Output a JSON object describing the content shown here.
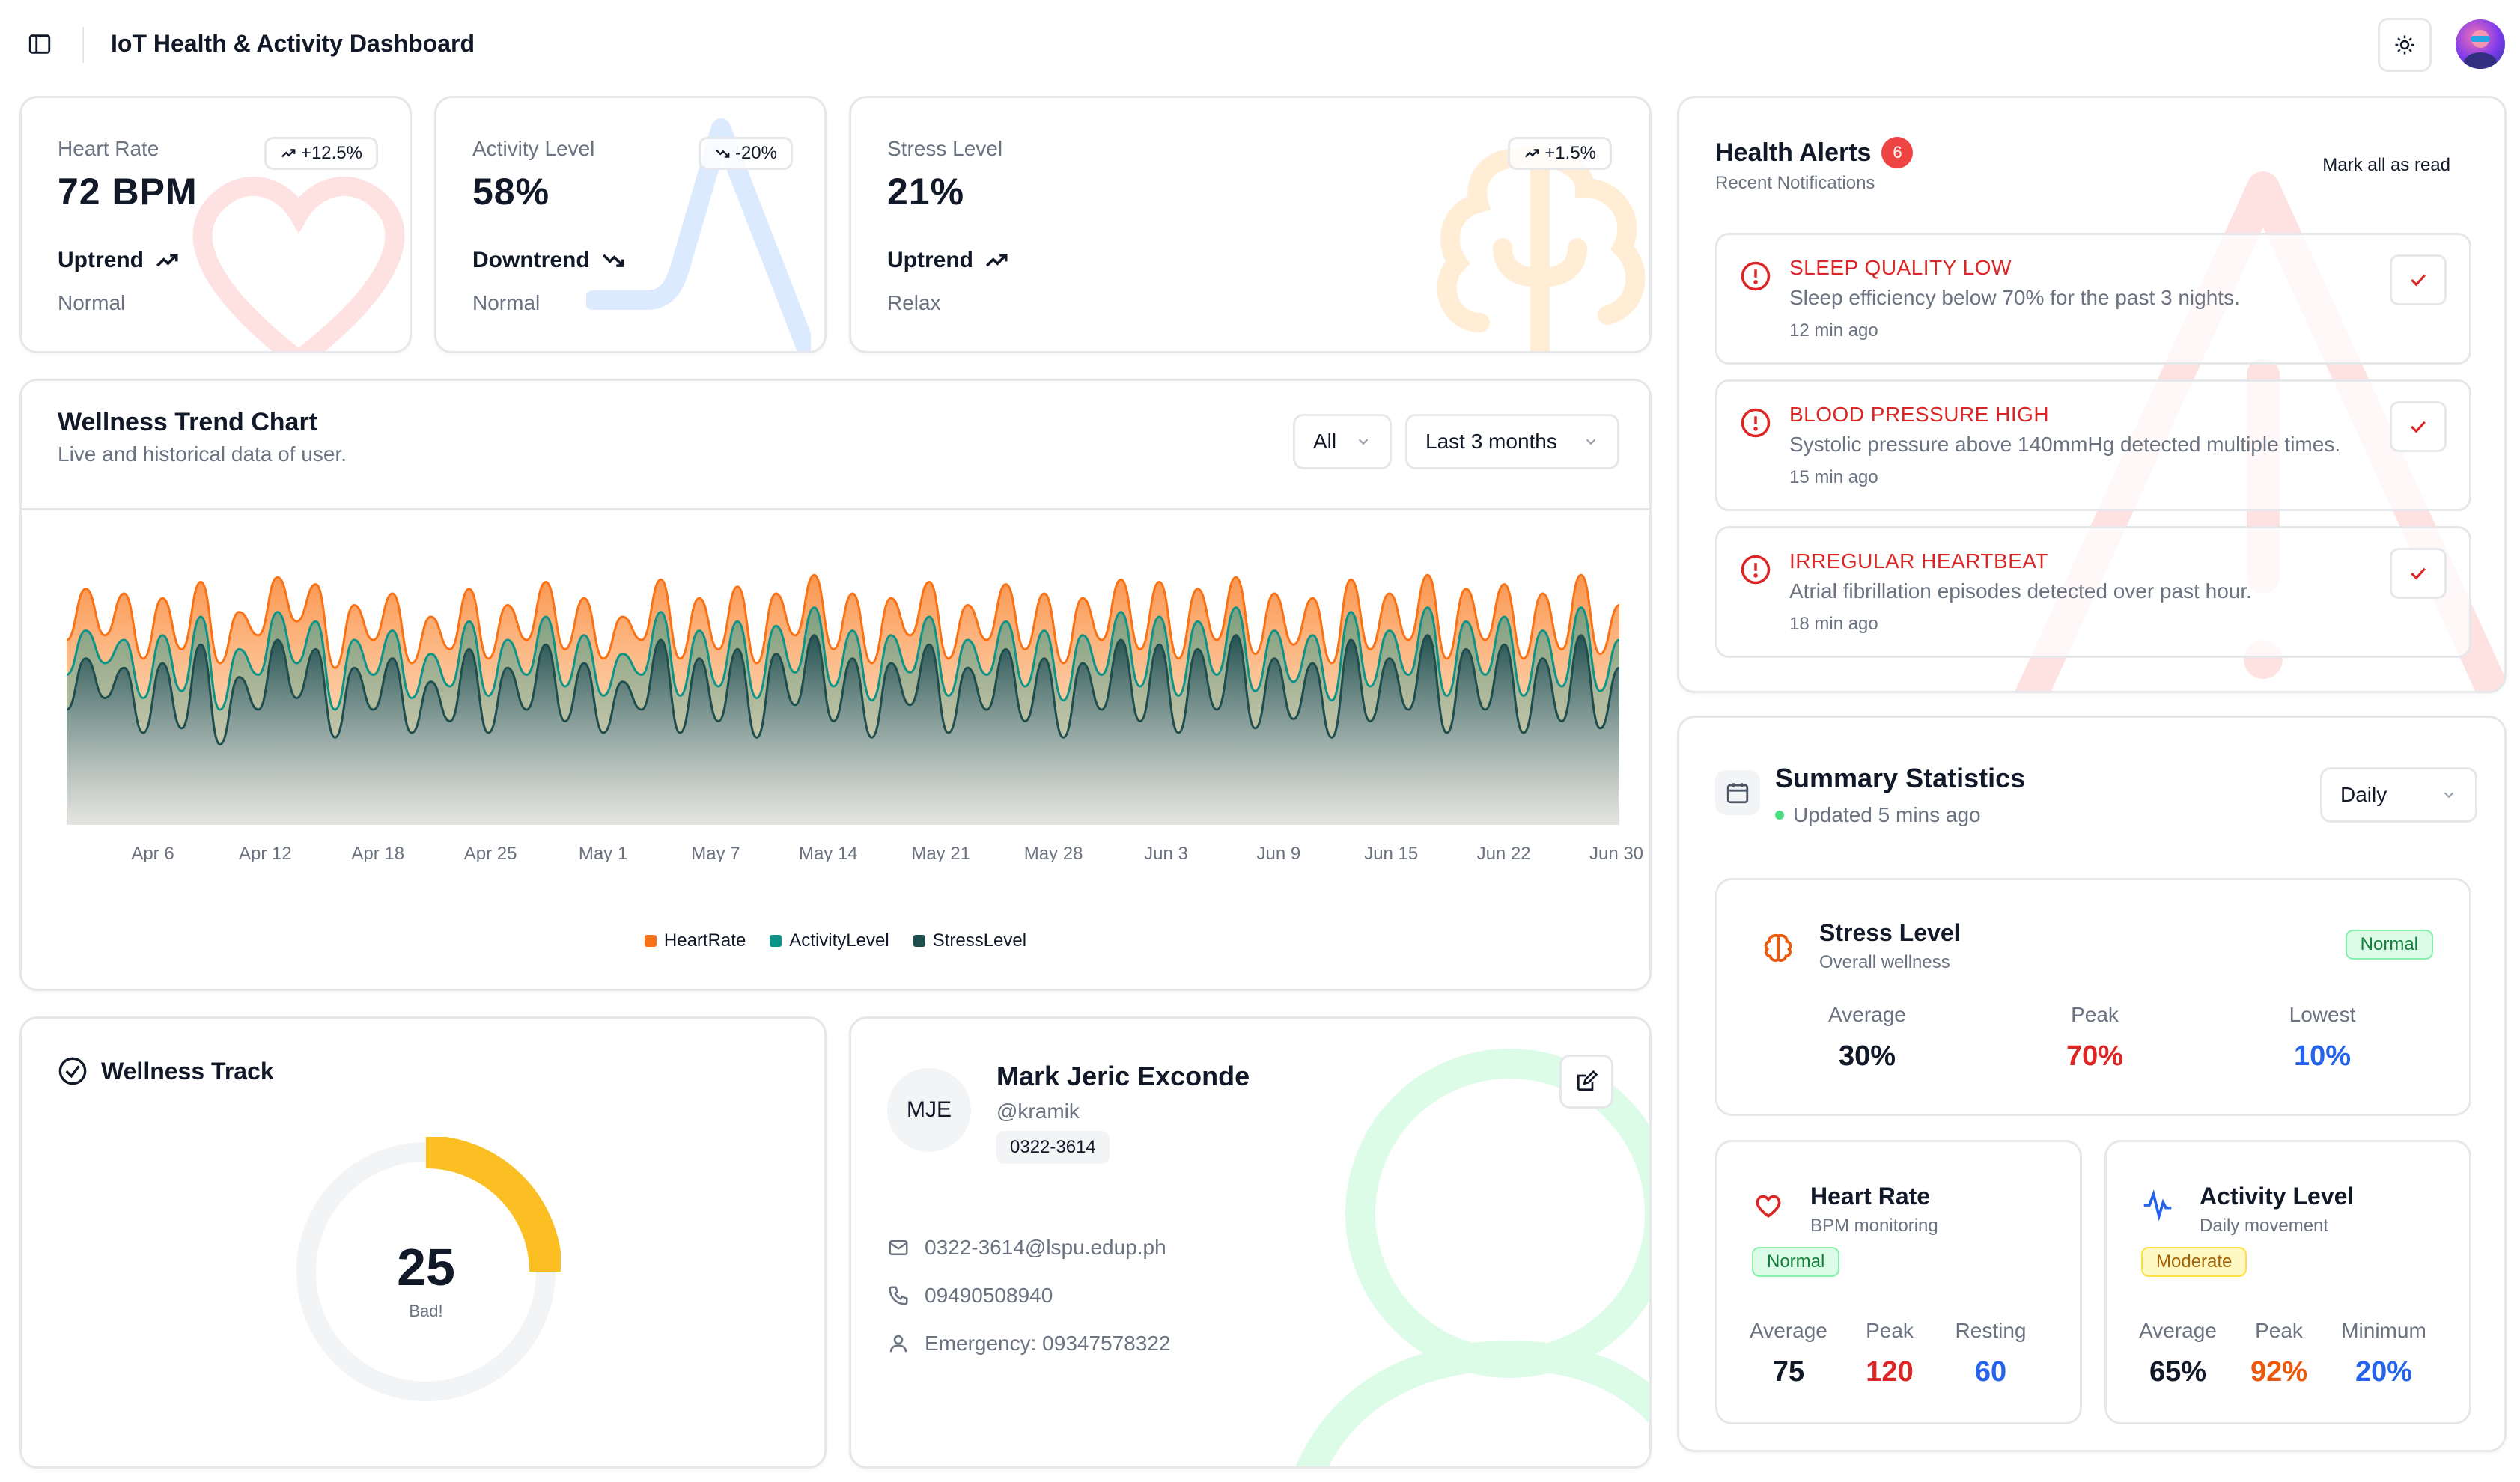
{
  "header": {
    "title": "IoT Health & Activity Dashboard"
  },
  "metrics": [
    {
      "label": "Heart Rate",
      "value": "72 BPM",
      "change": "+12.5%",
      "trend": "Uptrend",
      "status": "Normal"
    },
    {
      "label": "Activity Level",
      "value": "58%",
      "change": "-20%",
      "trend": "Downtrend",
      "status": "Normal"
    },
    {
      "label": "Stress Level",
      "value": "21%",
      "change": "+1.5%",
      "trend": "Uptrend",
      "status": "Relax"
    }
  ],
  "wellness_chart": {
    "title": "Wellness Trend Chart",
    "subtitle": "Live and historical data of user.",
    "filter_value": "All",
    "range_value": "Last 3 months"
  },
  "chart_data": {
    "type": "area",
    "x_tick_labels": [
      "Apr 6",
      "Apr 12",
      "Apr 18",
      "Apr 25",
      "May 1",
      "May 7",
      "May 14",
      "May 21",
      "May 28",
      "Jun 3",
      "Jun 9",
      "Jun 15",
      "Jun 22",
      "Jun 30"
    ],
    "series": [
      {
        "name": "HeartRate",
        "color": "#f97316",
        "values": [
          70,
          92,
          72,
          90,
          62,
          88,
          66,
          95,
          60,
          82,
          72,
          97,
          78,
          94,
          58,
          85,
          70,
          90,
          60,
          80,
          66,
          92,
          62,
          85,
          70,
          95,
          66,
          88,
          62,
          80,
          70,
          96,
          62,
          88,
          66,
          93,
          60,
          90,
          72,
          98,
          66,
          90,
          60,
          88,
          72,
          95,
          62,
          85,
          70,
          94,
          66,
          90,
          60,
          88,
          70,
          96,
          66,
          95,
          62,
          92,
          70,
          97,
          64,
          90,
          68,
          88,
          60,
          96,
          66,
          90,
          70,
          98,
          62,
          92,
          70,
          94,
          62,
          90,
          66,
          98,
          64,
          85
        ]
      },
      {
        "name": "ActivityLevel",
        "color": "#0d9488",
        "values": [
          55,
          74,
          60,
          70,
          45,
          72,
          48,
          80,
          40,
          66,
          55,
          82,
          60,
          78,
          40,
          70,
          55,
          74,
          45,
          64,
          50,
          78,
          46,
          70,
          55,
          80,
          50,
          72,
          46,
          64,
          55,
          82,
          46,
          74,
          50,
          78,
          45,
          76,
          56,
          84,
          50,
          74,
          44,
          72,
          56,
          80,
          46,
          70,
          55,
          78,
          50,
          74,
          44,
          72,
          55,
          82,
          50,
          80,
          46,
          78,
          55,
          84,
          48,
          74,
          52,
          72,
          44,
          82,
          50,
          74,
          55,
          84,
          46,
          78,
          55,
          80,
          46,
          74,
          50,
          84,
          48,
          70
        ]
      },
      {
        "name": "StressLevel",
        "color": "#1f4e4e",
        "values": [
          40,
          62,
          45,
          58,
          30,
          60,
          32,
          68,
          25,
          54,
          40,
          70,
          45,
          66,
          28,
          58,
          40,
          62,
          30,
          52,
          35,
          66,
          30,
          58,
          40,
          68,
          35,
          60,
          30,
          52,
          40,
          70,
          30,
          62,
          35,
          66,
          28,
          64,
          42,
          72,
          35,
          62,
          28,
          60,
          42,
          68,
          30,
          58,
          40,
          66,
          35,
          62,
          28,
          60,
          40,
          70,
          35,
          68,
          30,
          66,
          40,
          72,
          32,
          62,
          36,
          60,
          28,
          70,
          35,
          62,
          40,
          72,
          30,
          66,
          40,
          68,
          30,
          62,
          35,
          72,
          32,
          58
        ]
      }
    ],
    "legend_position": "bottom-center",
    "grid": false
  },
  "alerts": {
    "title": "Health Alerts",
    "count": "6",
    "subtitle": "Recent Notifications",
    "mark_all": "Mark all as read",
    "items": [
      {
        "title": "SLEEP QUALITY LOW",
        "desc": "Sleep efficiency below 70% for the past 3 nights.",
        "time": "12 min ago"
      },
      {
        "title": "BLOOD PRESSURE HIGH",
        "desc": "Systolic pressure above 140mmHg detected multiple times.",
        "time": "15 min ago"
      },
      {
        "title": "IRREGULAR HEARTBEAT",
        "desc": "Atrial fibrillation episodes detected over past hour.",
        "time": "18 min ago"
      }
    ]
  },
  "summary": {
    "title": "Summary Statistics",
    "updated": "Updated 5 mins ago",
    "period": "Daily",
    "stress": {
      "title": "Stress Level",
      "subtitle": "Overall wellness",
      "badge": "Normal",
      "labels": [
        "Average",
        "Peak",
        "Lowest"
      ],
      "values": [
        "30%",
        "70%",
        "10%"
      ]
    },
    "heart": {
      "title": "Heart Rate",
      "subtitle": "BPM monitoring",
      "badge": "Normal",
      "labels": [
        "Average",
        "Peak",
        "Resting"
      ],
      "values": [
        "75",
        "120",
        "60"
      ]
    },
    "activity": {
      "title": "Activity Level",
      "subtitle": "Daily movement",
      "badge": "Moderate",
      "labels": [
        "Average",
        "Peak",
        "Minimum"
      ],
      "values": [
        "65%",
        "92%",
        "20%"
      ]
    }
  },
  "wellness_track": {
    "title": "Wellness Track",
    "score": "25",
    "score_fraction": 0.25,
    "label": "Bad!"
  },
  "profile": {
    "initials": "MJE",
    "name": "Mark Jeric Exconde",
    "handle": "@kramik",
    "id_badge": "0322-3614",
    "email": "0322-3614@lspu.edup.ph",
    "phone": "09490508940",
    "emergency": "Emergency: 09347578322"
  },
  "colors": {
    "orange": "#f97316",
    "teal": "#0d9488",
    "dark_teal": "#1f4e4e",
    "red": "#dc2626",
    "blue": "#2563eb",
    "amber": "#fbbf24"
  }
}
